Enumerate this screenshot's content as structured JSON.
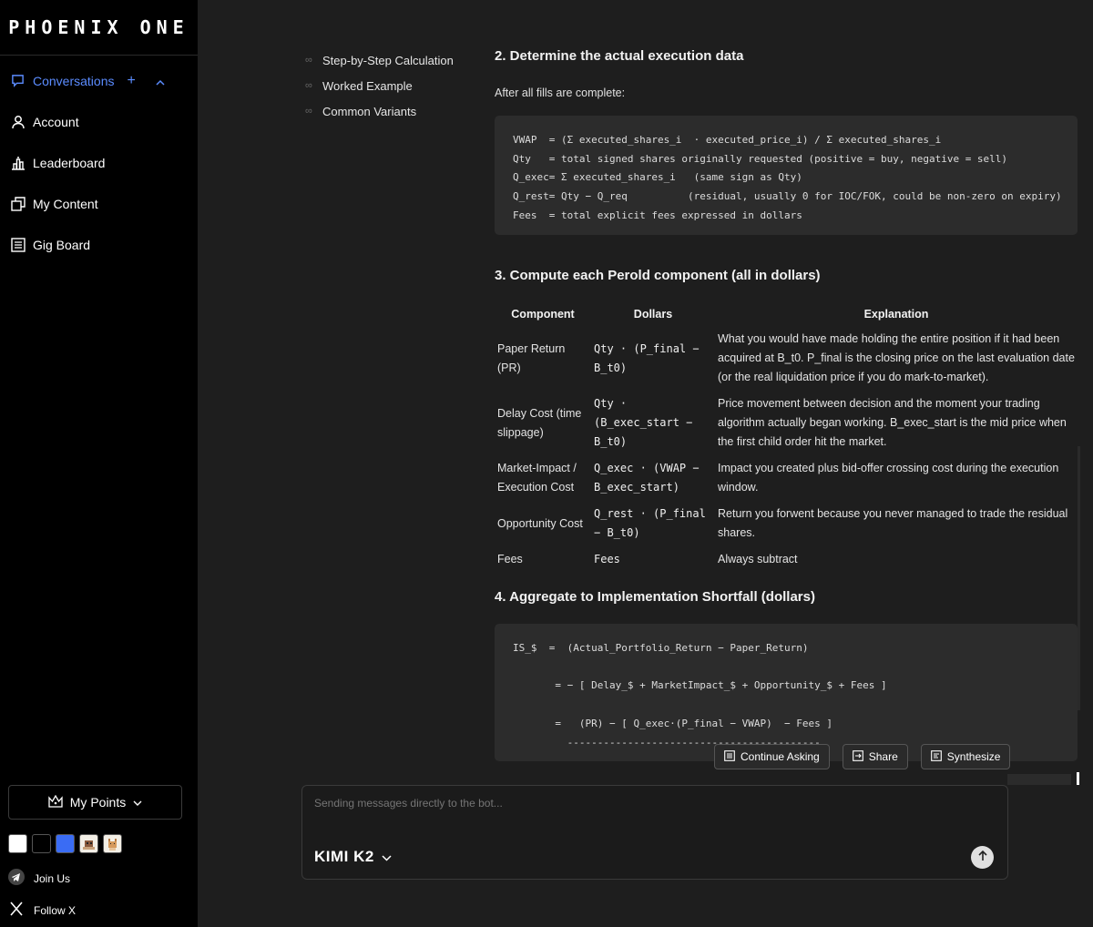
{
  "brand": {
    "name": "PHOENIX ONE"
  },
  "sidebar": {
    "items": [
      {
        "label": "Conversations"
      },
      {
        "label": "Account"
      },
      {
        "label": "Leaderboard"
      },
      {
        "label": "My Content"
      },
      {
        "label": "Gig Board"
      }
    ],
    "points_label": "My Points",
    "join_label": "Join Us",
    "follow_label": "Follow X",
    "swatch_colors": [
      "#ffffff",
      "#000000",
      "#3a6cf4"
    ]
  },
  "toc": [
    "Step-by-Step Calculation",
    "Worked Example",
    "Common Variants"
  ],
  "section2": {
    "title": "2. Determine the actual execution data",
    "intro": "After all fills are complete:",
    "code": "VWAP  = (Σ executed_shares_i  · executed_price_i) / Σ executed_shares_i\nQty   = total signed shares originally requested (positive = buy, negative = sell)\nQ_exec= Σ executed_shares_i   (same sign as Qty)\nQ_rest= Qty − Q_req          (residual, usually 0 for IOC/FOK, could be non-zero on expiry)\nFees  = total explicit fees expressed in dollars"
  },
  "section3": {
    "title": "3. Compute each Perold component (all in dollars)",
    "headers": [
      "Component",
      "Dollars",
      "Explanation"
    ],
    "rows": [
      {
        "component": "Paper Return (PR)",
        "dollars": "Qty · (P_final − B_t0)",
        "explanation": "What you would have made holding the entire position if it had been acquired at B_t0. P_final is the closing price on the last evaluation date (or the real liquidation price if you do mark-to-market)."
      },
      {
        "component": "Delay Cost (time slippage)",
        "dollars": "Qty · (B_exec_start − B_t0)",
        "explanation": "Price movement between decision and the moment your trading algorithm actually began working. B_exec_start is the mid price when the first child order hit the market."
      },
      {
        "component": "Market-Impact / Execution Cost",
        "dollars": "Q_exec · (VWAP − B_exec_start)",
        "explanation": "Impact you created plus bid-offer crossing cost during the execution window."
      },
      {
        "component": "Opportunity Cost",
        "dollars": "Q_rest · (P_final − B_t0)",
        "explanation": "Return you forwent because you never managed to trade the residual shares."
      },
      {
        "component": "Fees",
        "dollars": "Fees",
        "explanation": "Always subtract"
      }
    ]
  },
  "section4": {
    "title": "4. Aggregate to Implementation Shortfall (dollars)",
    "code": "IS_$  =  (Actual_Portfolio_Return − Paper_Return)\n\n       = − [ Delay_$ + MarketImpact_$ + Opportunity_$ + Fees ]\n\n       =   (PR) − [ Q_exec·(P_final − VWAP)  − Fees ]\n         ------------------------------------------"
  },
  "actions": {
    "continue_label": "Continue Asking",
    "share_label": "Share",
    "synthesize_label": "Synthesize"
  },
  "composer": {
    "placeholder": "Sending messages directly to the bot...",
    "model_name": "KIMI K2"
  }
}
